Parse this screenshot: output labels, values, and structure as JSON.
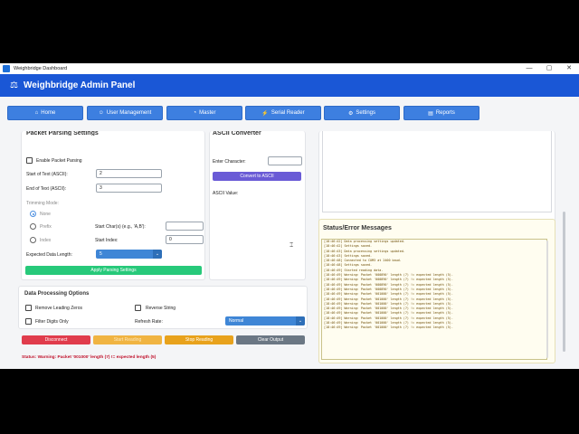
{
  "window": {
    "title": "Weighbridge Dashboard",
    "controls": [
      "—",
      "▢",
      "✕"
    ]
  },
  "header": {
    "title": "Weighbridge Admin Panel"
  },
  "nav": [
    {
      "label": "Home",
      "icon": "home-icon"
    },
    {
      "label": "User Management",
      "icon": "user-icon"
    },
    {
      "label": "Master",
      "icon": "gauge-icon"
    },
    {
      "label": "Serial Reader",
      "icon": "plug-icon"
    },
    {
      "label": "Settings",
      "icon": "gear-icon"
    },
    {
      "label": "Reports",
      "icon": "chart-icon"
    }
  ],
  "parsing": {
    "section_title": "Packet Parsing Settings",
    "enable_label": "Enable Packet Parsing",
    "start_label": "Start of Text (ASCII):",
    "start_value": "2",
    "end_label": "End of Text (ASCII):",
    "end_value": "3",
    "trimming_label": "Trimming Mode:",
    "radio_none": "None",
    "radio_prefix": "Prefix",
    "radio_index": "Index",
    "start_chars_label": "Start Char(s) (e.g., 'A,B'):",
    "start_chars_value": "",
    "start_index_label": "Start Index:",
    "start_index_value": "0",
    "expected_len_label": "Expected Data Length:",
    "expected_len_value": "5",
    "apply_button": "Apply Parsing Settings"
  },
  "converter": {
    "section_title": "ASCII Converter",
    "enter_label": "Enter Character:",
    "enter_value": "",
    "convert_button": "Convert to ASCII",
    "value_label": "ASCII Value:"
  },
  "processing": {
    "title": "Data Processing Options",
    "remove_zeros": "Remove Leading Zeros",
    "reverse": "Reverse String",
    "filter_digits": "Filter Digits Only",
    "refresh_label": "Refresh Rate:",
    "refresh_value": "Normal"
  },
  "actions": {
    "disconnect": "Disconnect",
    "start_reading": "Start Reading",
    "stop_reading": "Stop Reading",
    "clear_output": "Clear Output"
  },
  "status_line": "Status: Warning: Packet '001000' length (7) != expected length (5)",
  "status_panel": {
    "title": "Status/Error Messages",
    "lines": [
      "[18:46:42] Data processing settings updated.",
      "[18:46:42] Settings saved.",
      "[18:46:43] Data processing settings updated.",
      "[18:46:43] Settings saved.",
      "[18:46:48] Connected to COM3 at 2400 baud.",
      "[18:46:48] Settings saved.",
      "[18:46:49] Started reading data.",
      "[18:46:49] Warning: Packet '000890' length (7) != expected length (5).",
      "[18:46:49] Warning: Packet '000890' length (7) != expected length (5).",
      "[18:46:49] Warning: Packet '000890' length (7) != expected length (5).",
      "[18:46:49] Warning: Packet '000890' length (7) != expected length (5).",
      "[18:46:49] Warning: Packet '001000' length (7) != expected length (5).",
      "[18:46:49] Warning: Packet '001000' length (7) != expected length (5).",
      "[18:46:49] Warning: Packet '001000' length (7) != expected length (5).",
      "[18:46:49] Warning: Packet '001000' length (7) != expected length (5).",
      "[18:46:49] Warning: Packet '001000' length (7) != expected length (5).",
      "[18:46:49] Warning: Packet '001000' length (7) != expected length (5).",
      "[18:46:49] Warning: Packet '001000' length (7) != expected length (5).",
      "[18:46:49] Warning: Packet '001000' length (7) != expected length (5)."
    ]
  },
  "colors": {
    "header": "#1a57d6",
    "nav": "#3d7fe0",
    "apply": "#27c97a",
    "convert": "#6a5bd6",
    "disconnect": "#e03c4c",
    "start": "#f0b442",
    "stop": "#e8a21c",
    "clear": "#6b7784",
    "status_text": "#c0102a"
  }
}
